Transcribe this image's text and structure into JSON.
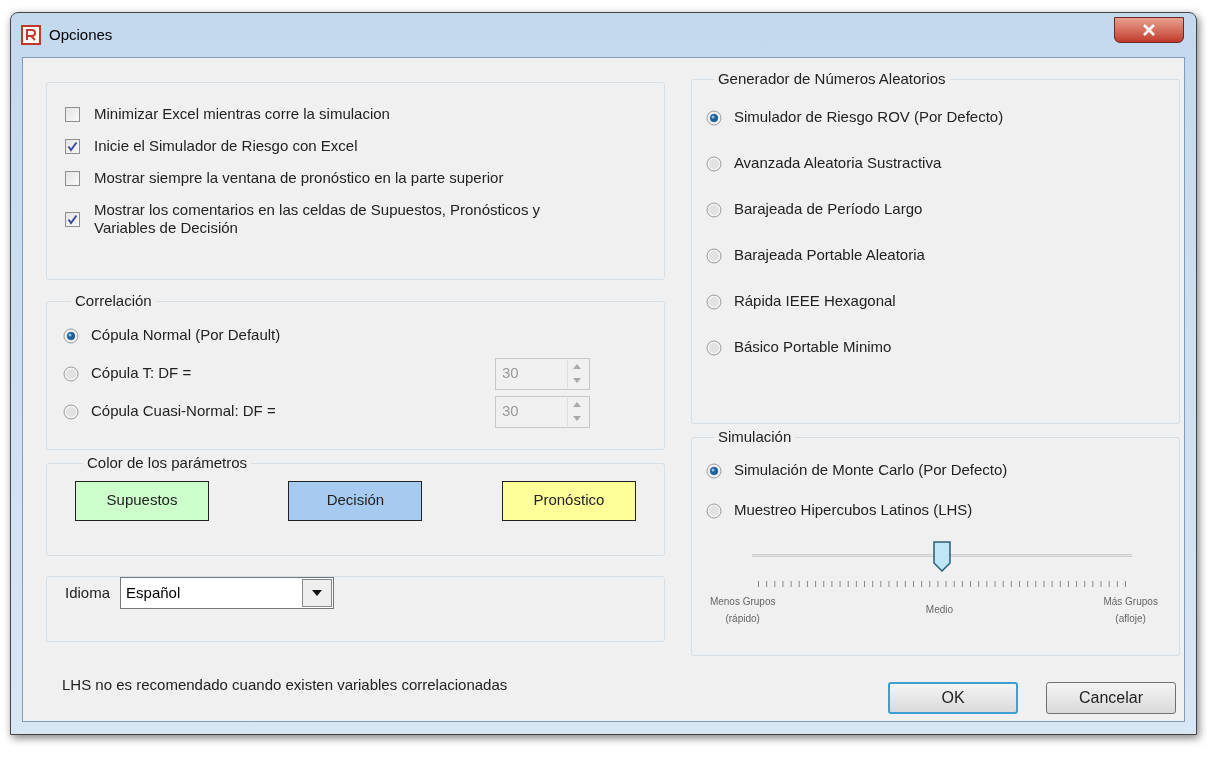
{
  "window": {
    "title": "Opciones"
  },
  "general_options": [
    {
      "label": "Minimizar Excel mientras corre la simulacion",
      "checked": false
    },
    {
      "label": "Inicie el Simulador de Riesgo con Excel",
      "checked": true
    },
    {
      "label": "Mostrar siempre la ventana de pronóstico en la parte superior",
      "checked": false
    },
    {
      "label": "Mostrar los comentarios en las celdas de Supuestos, Pronósticos y Variables de Decisión",
      "checked": true
    }
  ],
  "correlation": {
    "title": "Correlación",
    "options": [
      {
        "label": "Cópula Normal (Por Default)",
        "selected": true
      },
      {
        "label": "Cópula T: DF =",
        "selected": false,
        "df": "30",
        "disabled": true
      },
      {
        "label": "Cópula Cuasi-Normal: DF =",
        "selected": false,
        "df": "30",
        "disabled": true
      }
    ]
  },
  "parameter_colors": {
    "title": "Color de los parámetros",
    "items": [
      {
        "label": "Supuestos",
        "color": "#ccffcc"
      },
      {
        "label": "Decisión",
        "color": "#a6caf0"
      },
      {
        "label": "Pronóstico",
        "color": "#ffff99"
      }
    ]
  },
  "language": {
    "label": "Idioma",
    "value": "Español"
  },
  "note": "LHS no es recomendado cuando existen variables correlacionadas",
  "rng": {
    "title": "Generador de Números Aleatorios",
    "options": [
      {
        "label": "Simulador de Riesgo ROV (Por Defecto)",
        "selected": true
      },
      {
        "label": "Avanzada Aleatoria Sustractiva",
        "selected": false
      },
      {
        "label": "Barajeada de Período Largo",
        "selected": false
      },
      {
        "label": "Barajeada Portable Aleatoria",
        "selected": false
      },
      {
        "label": "Rápida IEEE Hexagonal",
        "selected": false
      },
      {
        "label": "Básico Portable Minimo",
        "selected": false
      }
    ]
  },
  "simulation": {
    "title": "Simulación",
    "options": [
      {
        "label": "Simulación de Monte Carlo (Por Defecto)",
        "selected": true
      },
      {
        "label": "Muestreo Hipercubos Latinos (LHS)",
        "selected": false
      }
    ],
    "slider": {
      "level": 0.5,
      "labels": [
        {
          "lines": [
            "Menos Grupos",
            "(rápido)"
          ]
        },
        {
          "lines": [
            "Medio"
          ]
        },
        {
          "lines": [
            "Más Grupos",
            "(afloje)"
          ]
        }
      ]
    }
  },
  "buttons": [
    {
      "label": "OK",
      "default": true
    },
    {
      "label": "Cancelar",
      "default": false
    }
  ]
}
